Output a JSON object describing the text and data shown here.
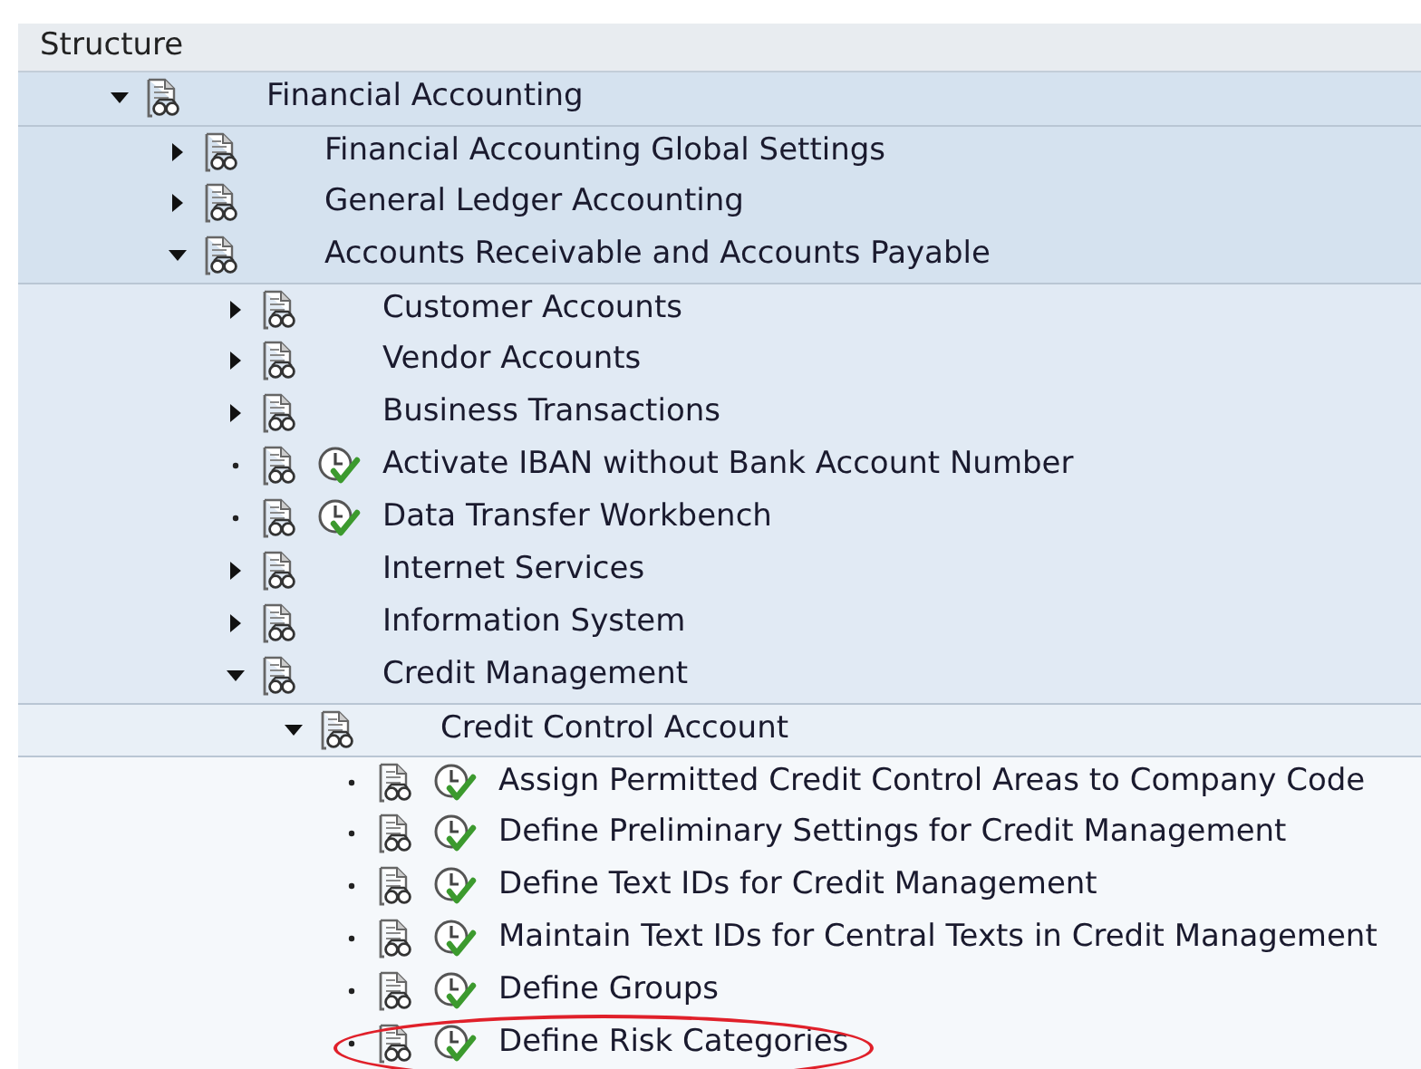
{
  "header": {
    "title": "Structure"
  },
  "tree": [
    {
      "label": "Financial Accounting",
      "kind": "folder",
      "expanded": true,
      "children": [
        {
          "label": "Financial Accounting Global Settings",
          "kind": "folder",
          "expanded": false
        },
        {
          "label": "General Ledger Accounting",
          "kind": "folder",
          "expanded": false
        },
        {
          "label": "Accounts Receivable and Accounts Payable",
          "kind": "folder",
          "expanded": true,
          "children": [
            {
              "label": "Customer Accounts",
              "kind": "folder",
              "expanded": false
            },
            {
              "label": "Vendor Accounts",
              "kind": "folder",
              "expanded": false
            },
            {
              "label": "Business Transactions",
              "kind": "folder",
              "expanded": false
            },
            {
              "label": "Activate IBAN without Bank Account Number",
              "kind": "activity",
              "highlighted": false
            },
            {
              "label": "Data Transfer Workbench",
              "kind": "activity",
              "highlighted": false
            },
            {
              "label": "Internet Services",
              "kind": "folder",
              "expanded": false
            },
            {
              "label": "Information System",
              "kind": "folder",
              "expanded": false
            },
            {
              "label": "Credit Management",
              "kind": "folder",
              "expanded": true,
              "children": [
                {
                  "label": "Credit Control Account",
                  "kind": "folder",
                  "expanded": true,
                  "children": [
                    {
                      "label": "Assign Permitted Credit Control Areas to Company Code",
                      "kind": "activity",
                      "highlighted": false
                    },
                    {
                      "label": "Define Preliminary Settings for Credit Management",
                      "kind": "activity",
                      "highlighted": false
                    },
                    {
                      "label": "Define Text IDs for Credit Management",
                      "kind": "activity",
                      "highlighted": false
                    },
                    {
                      "label": "Maintain Text IDs for Central Texts in Credit Management",
                      "kind": "activity",
                      "highlighted": false
                    },
                    {
                      "label": "Define Groups",
                      "kind": "activity",
                      "highlighted": false
                    },
                    {
                      "label": "Define Risk Categories",
                      "kind": "activity",
                      "highlighted": true
                    }
                  ]
                }
              ]
            }
          ]
        }
      ]
    }
  ]
}
